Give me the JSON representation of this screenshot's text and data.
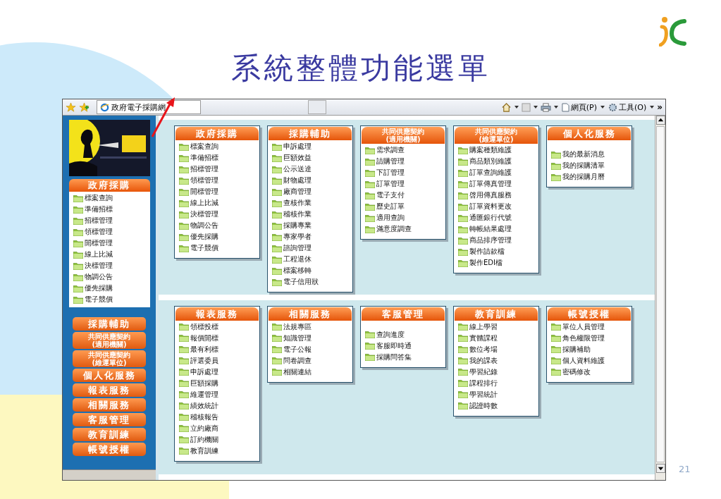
{
  "slide": {
    "title": "系統整體功能選單",
    "page_number": "21"
  },
  "browser": {
    "tab_title": "政府電子採購網",
    "page_menu": "網頁(P)",
    "tools_menu": "工具(O)",
    "more": "»"
  },
  "sidebar": {
    "menu_title": "政府採購",
    "items": [
      "標案查詢",
      "準備招標",
      "招標管理",
      "領標管理",
      "開標管理",
      "線上比減",
      "決標管理",
      "物調公告",
      "優先採購",
      "電子競價"
    ],
    "buttons": [
      {
        "label": "採購輔助"
      },
      {
        "label": "共同供應契約",
        "sublabel": "(適用機關)"
      },
      {
        "label": "共同供應契約",
        "sublabel": "(維運單位)"
      },
      {
        "label": "個人化服務"
      },
      {
        "label": "報表服務"
      },
      {
        "label": "相關服務"
      },
      {
        "label": "客服管理"
      },
      {
        "label": "教育訓練"
      },
      {
        "label": "帳號授權"
      }
    ]
  },
  "panels": [
    {
      "cards": [
        {
          "title": "政府採購",
          "items": [
            "標案查詢",
            "準備招標",
            "招標管理",
            "領標管理",
            "開標管理",
            "線上比減",
            "決標管理",
            "物調公告",
            "優先採購",
            "電子競價"
          ]
        },
        {
          "title": "採購輔助",
          "items": [
            "申訴處理",
            "巨額效益",
            "公示送達",
            "財物處理",
            "廠商管理",
            "查核作業",
            "稽核作業",
            "採購專業",
            "專家學者",
            "諮詢管理",
            "工程退休",
            "標案移轉",
            "電子信用狀"
          ]
        },
        {
          "title": "共同供應契約",
          "subtitle": "(適用機關)",
          "items": [
            "需求調查",
            "請購管理",
            "下訂管理",
            "訂單管理",
            "電子支付",
            "歷史訂單",
            "適用查詢",
            "滿意度調查"
          ]
        },
        {
          "title": "共同供應契約",
          "subtitle": "(維運單位)",
          "items": [
            "購案種類維護",
            "商品類別維護",
            "訂單查詢維護",
            "訂單傳真管理",
            "啓用傳真服務",
            "訂單資料更改",
            "通匯銀行代號",
            "轉帳結果處理",
            "商品排序管理",
            "製作請款檔",
            "製作EDI檔"
          ]
        },
        {
          "title": "個人化服務",
          "items": [
            "我的最新消息",
            "我的採購清單",
            "我的採購月曆"
          ]
        }
      ]
    },
    {
      "cards": [
        {
          "title": "報表服務",
          "items": [
            "領標投標",
            "報價開標",
            "最有利標",
            "評選委員",
            "申訴處理",
            "巨額採購",
            "維運管理",
            "績效統計",
            "稽核報告",
            "立約廠商",
            "訂約機關",
            "教育訓練"
          ]
        },
        {
          "title": "相關服務",
          "items": [
            "法規專區",
            "知識管理",
            "電子公報",
            "問卷調查",
            "相關連結"
          ]
        },
        {
          "title": "客服管理",
          "items": [
            "查詢進度",
            "客服即時通",
            "採購問答集"
          ]
        },
        {
          "title": "教育訓練",
          "items": [
            "線上學習",
            "實體課程",
            "數位考場",
            "我的課表",
            "學習紀錄",
            "課程排行",
            "學習統計",
            "認證時數"
          ]
        },
        {
          "title": "帳號授權",
          "items": [
            "單位人員管理",
            "角色權限管理",
            "採購補助",
            "個人資料維護",
            "密碼修改"
          ]
        }
      ]
    }
  ]
}
